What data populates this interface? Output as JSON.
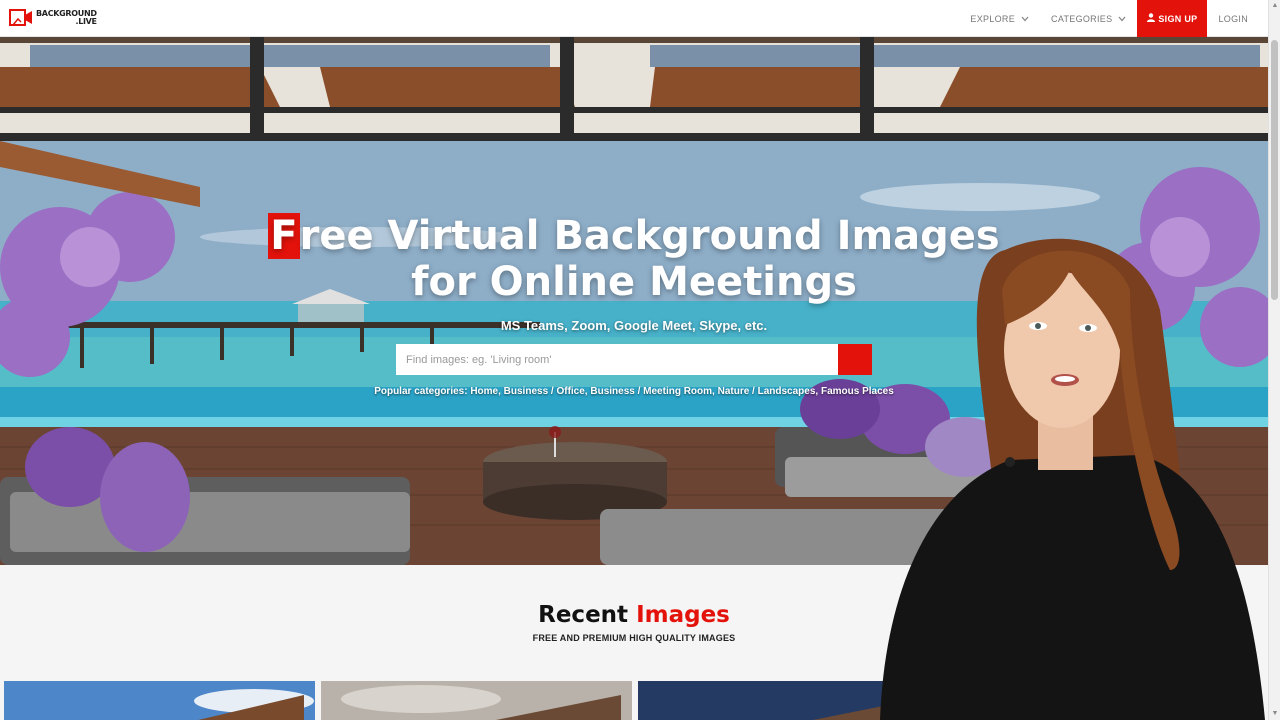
{
  "logo": {
    "line1": "BACKGROUND",
    "line2": ".LIVE"
  },
  "nav": {
    "explore": "EXPLORE",
    "categories": "CATEGORIES",
    "signup": "SIGN UP",
    "login": "LOGIN"
  },
  "hero": {
    "title_first_letter": "F",
    "title_rest_line1": "ree Virtual Background Images",
    "title_line2": "for Online Meetings",
    "subtitle": "MS Teams, Zoom, Google Meet, Skype, etc.",
    "search_placeholder": "Find images: eg. 'Living room'",
    "popular": "Popular categories: Home, Business / Office, Business / Meeting Room, Nature / Landscapes, Famous Places"
  },
  "recent": {
    "title_part1": "Recent",
    "title_part2": "Images",
    "subtitle": "FREE AND PREMIUM HIGH QUALITY IMAGES"
  },
  "icons": {
    "search": "search-icon",
    "user": "user-icon",
    "chevron": "chevron-down-icon"
  },
  "colors": {
    "accent": "#e3120b"
  }
}
